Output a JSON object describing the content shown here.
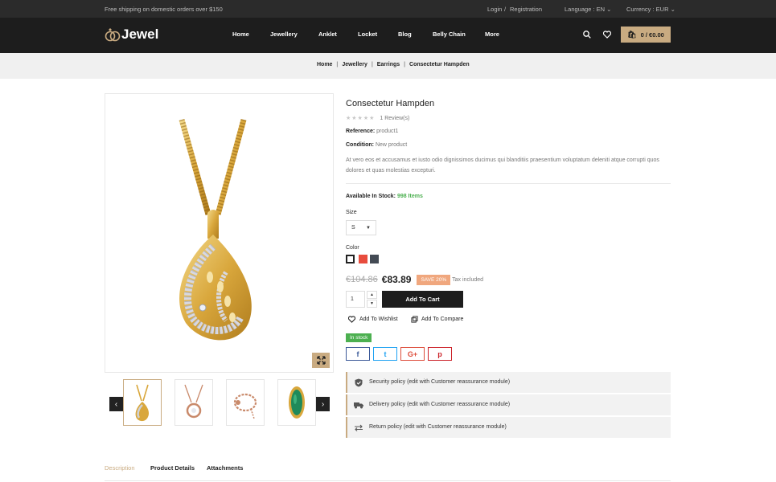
{
  "topbar": {
    "shipping": "Free shipping on domestic orders over $150",
    "login": "Login",
    "separator": "/",
    "registration": "Registration",
    "language": "Language : EN",
    "currency": "Currency : EUR"
  },
  "header": {
    "logo": "Jewel",
    "menu": [
      "Home",
      "Jewellery",
      "Anklet",
      "Locket",
      "Blog",
      "Belly Chain",
      "More"
    ],
    "cart": "0 / €0.00"
  },
  "breadcrumb": [
    "Home",
    "Jewellery",
    "Earrings",
    "Consectetur Hampden"
  ],
  "breadcrumb_sep": "|",
  "product": {
    "title": "Consectetur Hampden",
    "rating": 0,
    "stars_max": 5,
    "reviews": "1 Review(s)",
    "reference_label": "Reference:",
    "reference": "product1",
    "condition_label": "Condition:",
    "condition": "New product",
    "description": "At vero eos et accusamus et iusto odio dignissimos ducimus qui blanditiis praesentium voluptatum deleniti atque corrupti quos dolores et quas molestias excepturi.",
    "stock_label": "Available In Stock:",
    "stock": "998 Items",
    "size_label": "Size",
    "size_value": "S",
    "color_label": "Color",
    "colors": [
      "#ffffff",
      "#e84c3d",
      "#434a54"
    ],
    "old_price": "€104.86",
    "price": "€83.89",
    "discount": "SAVE 20%",
    "tax": "Tax included",
    "qty": "1",
    "add_to_cart": "Add To Cart",
    "wishlist": "Add To Wishlist",
    "compare": "Add To Compare",
    "in_stock_badge": "In stock"
  },
  "share": [
    "f",
    "t",
    "G+",
    "p"
  ],
  "share_colors": [
    "#3b5998",
    "#1da1f2",
    "#dd4b39",
    "#cb2027"
  ],
  "policies": [
    "Security policy (edit with Customer reassurance module)",
    "Delivery policy (edit with Customer reassurance module)",
    "Return policy (edit with Customer reassurance module)"
  ],
  "tabs": [
    "Description",
    "Product Details",
    "Attachments"
  ],
  "accent": "#c9ab81"
}
